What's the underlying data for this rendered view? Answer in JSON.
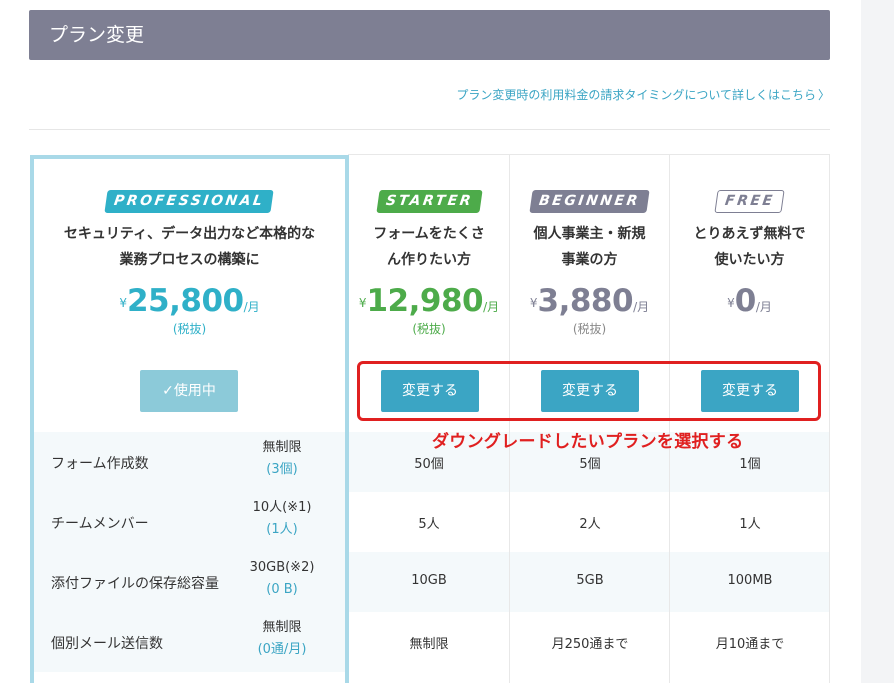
{
  "header": {
    "title": "プラン変更"
  },
  "timing_link": {
    "text": "プラン変更時の利用料金の請求タイミングについて詳しくはこちら",
    "chevron": "〉"
  },
  "plans": [
    {
      "key": "pro",
      "badge": "PROFESSIONAL",
      "desc1": "セキュリティ、データ出力など本格的な",
      "desc2": "業務プロセスの構築に",
      "yen": "¥",
      "amount": "25,800",
      "unit": "/月",
      "tax": "(税抜)",
      "button": "✓使用中",
      "color": "#2fb0c8"
    },
    {
      "key": "starter",
      "badge": "STARTER",
      "desc1": "フォームをたくさ",
      "desc2": "ん作りたい方",
      "yen": "¥",
      "amount": "12,980",
      "unit": "/月",
      "tax": "(税抜)",
      "button": "変更する",
      "color": "#4dab4a"
    },
    {
      "key": "beginner",
      "badge": "BEGINNER",
      "desc1": "個人事業主・新規",
      "desc2": "事業の方",
      "yen": "¥",
      "amount": "3,880",
      "unit": "/月",
      "tax": "(税抜)",
      "button": "変更する",
      "color": "#7e7f93"
    },
    {
      "key": "free",
      "badge": "FREE",
      "desc1": "とりあえず無料で",
      "desc2": "使いたい方",
      "yen": "¥",
      "amount": "0",
      "unit": "/月",
      "tax": "",
      "button": "変更する",
      "color": "#7e7f93"
    }
  ],
  "annotation": "ダウングレードしたいプランを選択する",
  "features": [
    {
      "label": "フォーム作成数",
      "pro_limit": "無制限",
      "pro_used": "(3個)",
      "starter": "50個",
      "beginner": "5個",
      "free": "1個"
    },
    {
      "label": "チームメンバー",
      "pro_limit": "10人(※1)",
      "pro_used": "(1人)",
      "starter": "5人",
      "beginner": "2人",
      "free": "1人"
    },
    {
      "label": "添付ファイルの保存総容量",
      "pro_limit": "30GB(※2)",
      "pro_used": "(0 B)",
      "starter": "10GB",
      "beginner": "5GB",
      "free": "100MB"
    },
    {
      "label": "個別メール送信数",
      "pro_limit": "無制限",
      "pro_used": "(0通/月)",
      "starter": "無制限",
      "beginner": "月250通まで",
      "free": "月10通まで"
    }
  ]
}
